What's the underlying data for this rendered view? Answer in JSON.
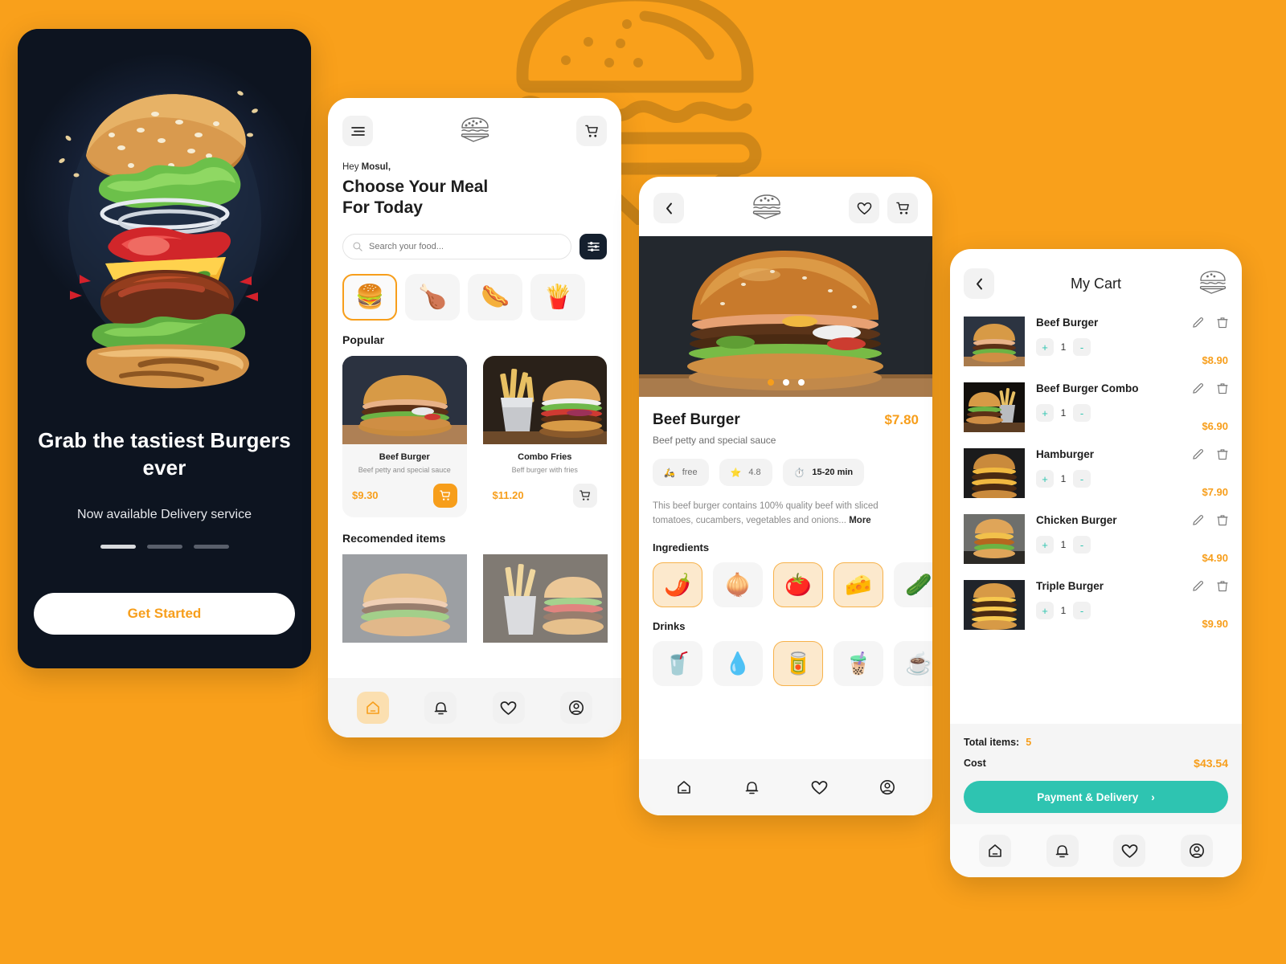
{
  "theme": {
    "background": "#F9A01B",
    "accent_orange": "#F79E1B",
    "teal": "#2EC4B1",
    "dark": "#0D1420"
  },
  "onboarding": {
    "title": "Grab the tastiest Burgers ever",
    "subtitle": "Now available Delivery service",
    "cta_label": "Get Started",
    "dots": 3,
    "active_dot": 0
  },
  "home": {
    "menu_icon": "hamburger-menu-icon",
    "logo_icon": "burger-logo-icon",
    "cart_icon": "shopping-cart-icon",
    "greeting_prefix": "Hey",
    "greeting_name": "Mosul,",
    "heading_line1": "Choose Your Meal",
    "heading_line2": "For Today",
    "search_placeholder": "Search your food...",
    "search_value": "",
    "filter_icon": "sliders-filter-icon",
    "categories": [
      {
        "name": "burger",
        "glyph": "🍔",
        "selected": true
      },
      {
        "name": "chicken",
        "glyph": "🍗",
        "selected": false
      },
      {
        "name": "hotdog",
        "glyph": "🌭",
        "selected": false
      },
      {
        "name": "fries",
        "glyph": "🍟",
        "selected": false
      }
    ],
    "popular_label": "Popular",
    "popular": [
      {
        "name": "Beef Burger",
        "desc": "Beef petty and special sauce",
        "price": "$9.30",
        "in_cart": true
      },
      {
        "name": "Combo Fries",
        "desc": "Beff burger with fries",
        "price": "$11.20",
        "in_cart": false
      }
    ],
    "recommended_label": "Recomended items",
    "nav": [
      {
        "name": "home",
        "selected": true
      },
      {
        "name": "notifications",
        "selected": false
      },
      {
        "name": "favorites",
        "selected": false
      },
      {
        "name": "profile",
        "selected": false
      }
    ]
  },
  "detail": {
    "back_icon": "chevron-left-icon",
    "logo_icon": "burger-logo-icon",
    "favorite_icon": "heart-icon",
    "cart_icon": "shopping-cart-icon",
    "carousel_dots": 3,
    "carousel_active": 0,
    "title": "Beef Burger",
    "price": "$7.80",
    "subtitle": "Beef petty and special sauce",
    "badges": [
      {
        "name": "delivery",
        "glyph": "🛵",
        "label": "free",
        "bold": false
      },
      {
        "name": "rating",
        "glyph": "⭐",
        "label": "4.8",
        "bold": false
      },
      {
        "name": "prep-time",
        "glyph": "⏱️",
        "label": "15-20 min",
        "bold": true
      }
    ],
    "description": "This beef burger contains 100% quality beef with sliced tomatoes, cucambers, vegetables and onions...",
    "more_label": "More",
    "ingredients_label": "Ingredients",
    "ingredients": [
      {
        "name": "chili",
        "glyph": "🌶️",
        "selected": true
      },
      {
        "name": "onion",
        "glyph": "🧅",
        "selected": false
      },
      {
        "name": "tomato",
        "glyph": "🍅",
        "selected": true
      },
      {
        "name": "cheese",
        "glyph": "🧀",
        "selected": true
      },
      {
        "name": "cucumber",
        "glyph": "🥒",
        "selected": false
      }
    ],
    "drinks_label": "Drinks",
    "drinks": [
      {
        "name": "soda-cup",
        "glyph": "🥤",
        "selected": false
      },
      {
        "name": "water-bottle",
        "glyph": "💧",
        "selected": false
      },
      {
        "name": "soda-can",
        "glyph": "🥫",
        "selected": true
      },
      {
        "name": "iced-coffee",
        "glyph": "🧋",
        "selected": false
      },
      {
        "name": "hot-tea",
        "glyph": "☕",
        "selected": false
      }
    ],
    "nav": [
      {
        "name": "home",
        "selected": false
      },
      {
        "name": "notifications",
        "selected": false
      },
      {
        "name": "favorites",
        "selected": false
      },
      {
        "name": "profile",
        "selected": false
      }
    ]
  },
  "cart": {
    "back_icon": "chevron-left-icon",
    "title": "My Cart",
    "logo_icon": "burger-logo-icon",
    "items": [
      {
        "name": "Beef Burger",
        "qty": "1",
        "price": "$8.90"
      },
      {
        "name": "Beef Burger Combo",
        "qty": "1",
        "price": "$6.90"
      },
      {
        "name": "Hamburger",
        "qty": "1",
        "price": "$7.90"
      },
      {
        "name": "Chicken Burger",
        "qty": "1",
        "price": "$4.90"
      },
      {
        "name": "Triple Burger",
        "qty": "1",
        "price": "$9.90"
      }
    ],
    "plus_label": "+",
    "minus_label": "-",
    "edit_icon": "pencil-edit-icon",
    "delete_icon": "trash-delete-icon",
    "total_items_label": "Total items:",
    "total_items_value": "5",
    "cost_label": "Cost",
    "cost_value": "$43.54",
    "pay_label": "Payment & Delivery",
    "pay_chevron": "›",
    "nav": [
      {
        "name": "home",
        "selected": false
      },
      {
        "name": "notifications",
        "selected": false
      },
      {
        "name": "favorites",
        "selected": false
      },
      {
        "name": "profile",
        "selected": false
      }
    ]
  }
}
